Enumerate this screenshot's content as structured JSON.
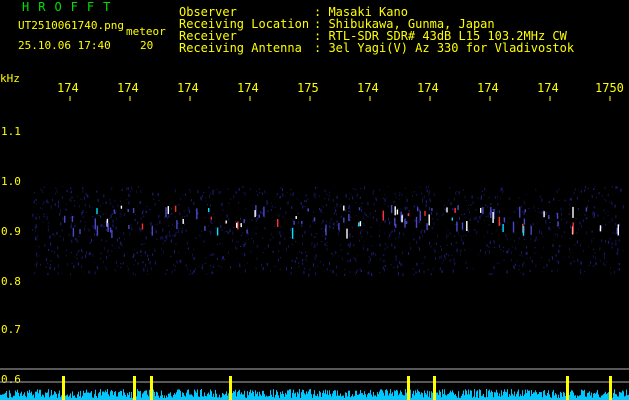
{
  "window": {
    "app_title": "HROFFT",
    "filename": "UT2510061740.png",
    "tag": "meteor",
    "datetime": "25.10.06 17:40",
    "count": "20"
  },
  "info": {
    "rows": [
      {
        "label": "Observer",
        "value": ": Masaki Kano"
      },
      {
        "label": "Receiving Location",
        "value": ": Shibukawa, Gunma, Japan"
      },
      {
        "label": "Receiver",
        "value": ": RTL-SDR SDR# 43dB L15 103.2MHz CW"
      },
      {
        "label": "Receiving Antenna",
        "value": ": 3el Yagi(V) Az 330 for Vladivostok"
      }
    ]
  },
  "axes": {
    "unit": "kHz",
    "time_ticks": [
      "174",
      "174",
      "174",
      "174",
      "175",
      "174",
      "174",
      "174",
      "174",
      "1750"
    ],
    "freq_ticks": [
      "1.1",
      "1.0",
      "0.9",
      "0.8",
      "0.7",
      "0.6"
    ]
  },
  "colors": {
    "background": "#000000",
    "header_text": "#ffff00",
    "title_text": "#00e000",
    "noise_band": "#1a1a6e",
    "signal_hot": "#ff3030",
    "signal_mid": "#00e0ff",
    "power_trace": "#00c8ff",
    "power_peak": "#ffff00"
  }
}
